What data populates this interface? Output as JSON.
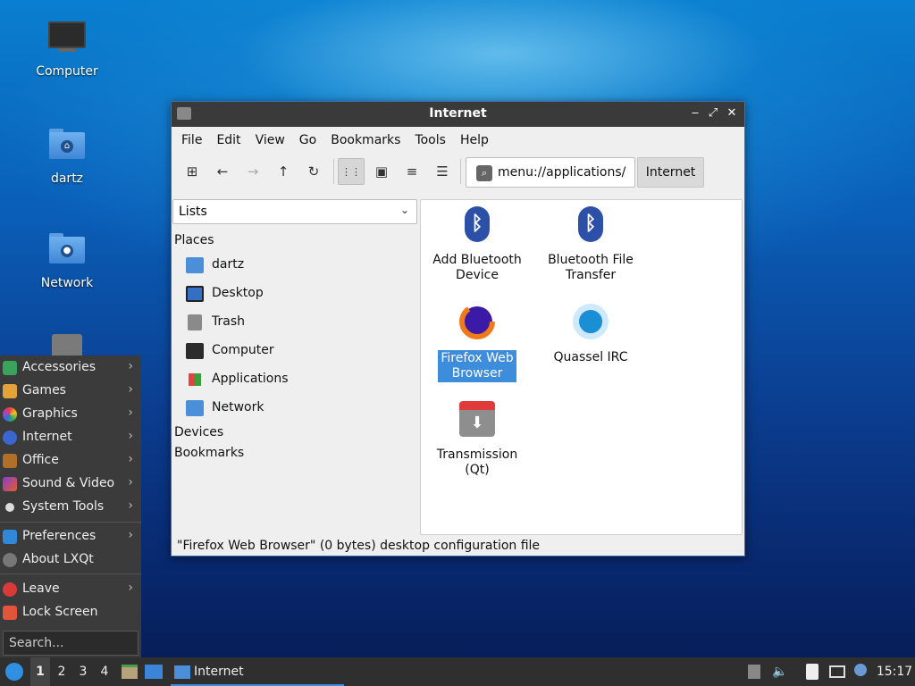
{
  "desktop": {
    "icons": [
      {
        "label": "Computer",
        "icon": "computer-icon"
      },
      {
        "label": "dartz",
        "icon": "home-folder-icon"
      },
      {
        "label": "Network",
        "icon": "network-folder-icon"
      },
      {
        "label": "",
        "icon": "trash-icon"
      }
    ]
  },
  "window": {
    "title": "Internet",
    "controls": {
      "minimize": "‒",
      "maximize": "⤢",
      "close": "✕"
    },
    "menu": [
      "File",
      "Edit",
      "View",
      "Go",
      "Bookmarks",
      "Tools",
      "Help"
    ],
    "toolbar": {
      "new_tab": "⊞",
      "back": "←",
      "forward": "→",
      "up": "↑",
      "reload": "↻",
      "view_icons": "⋮⋮",
      "view_thumbs": "▣",
      "view_compact": "≡",
      "view_detailed": "☰"
    },
    "address": "menu://applications/",
    "breadcrumb": "Internet",
    "side": {
      "selector": "Lists",
      "places_header": "Places",
      "places": [
        "dartz",
        "Desktop",
        "Trash",
        "Computer",
        "Applications",
        "Network"
      ],
      "devices_header": "Devices",
      "bookmarks_header": "Bookmarks"
    },
    "files": [
      {
        "name_line1": "Add Bluetooth",
        "name_line2": "Device",
        "icon": "bluetooth-icon"
      },
      {
        "name_line1": "Bluetooth File",
        "name_line2": "Transfer",
        "icon": "bluetooth-icon"
      },
      {
        "name_line1": "Firefox Web",
        "name_line2": "Browser",
        "icon": "firefox-icon",
        "selected": true
      },
      {
        "name_line1": "Quassel IRC",
        "name_line2": "",
        "icon": "quassel-icon"
      },
      {
        "name_line1": "Transmission",
        "name_line2": "(Qt)",
        "icon": "transmission-icon"
      }
    ],
    "status": "\"Firefox Web Browser\" (0 bytes) desktop configuration file"
  },
  "start_menu": {
    "items": [
      "Accessories",
      "Games",
      "Graphics",
      "Internet",
      "Office",
      "Sound & Video",
      "System Tools"
    ],
    "items2": [
      "Preferences",
      "About LXQt"
    ],
    "items3": [
      "Leave",
      "Lock Screen"
    ],
    "search_placeholder": "Search..."
  },
  "taskbar": {
    "desktops": [
      "1",
      "2",
      "3",
      "4"
    ],
    "task_label": "Internet",
    "clock": "15:17"
  },
  "colors": {
    "selection": "#3e8ddd",
    "titlebar": "#3a3a3a",
    "panel": "#2f2f2f"
  }
}
